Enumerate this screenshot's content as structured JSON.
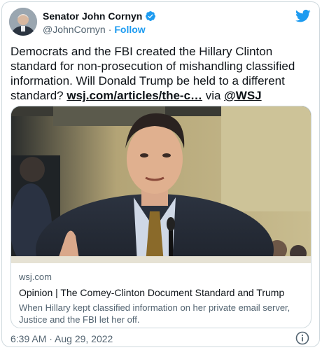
{
  "account": {
    "display_name": "Senator John Cornyn",
    "handle": "@JohnCornyn",
    "separator": "·",
    "follow_label": "Follow"
  },
  "tweet": {
    "text": "Democrats and the FBI created the Hillary Clinton standard for non-prosecution of mishandling classified information. Will Donald Trump be held to a different standard? ",
    "link_text": "wsj.com/articles/the-c…",
    "via_text": " via ",
    "mention": "@WSJ"
  },
  "link_card": {
    "domain": "wsj.com",
    "title": "Opinion | The Comey-Clinton Document Standard and Trump",
    "description": "When Hillary kept classified information on her private email server, Justice and the FBI let her off."
  },
  "footer": {
    "timestamp": "6:39 AM · Aug 29, 2022"
  },
  "icons": {
    "verified": "verified-badge-icon",
    "brand": "twitter-bird-icon",
    "info": "info-icon"
  },
  "colors": {
    "accent": "#1d9bf0",
    "text": "#0f1419",
    "muted": "#536471",
    "border": "#cfd9de"
  }
}
